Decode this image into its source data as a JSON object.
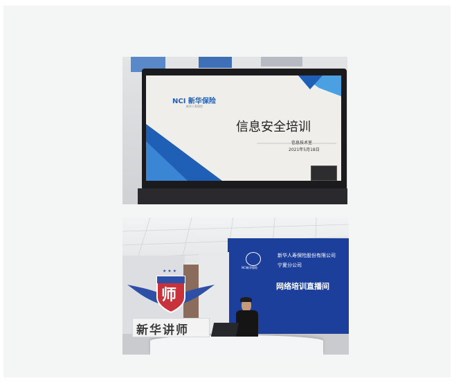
{
  "photo_laptop": {
    "slide": {
      "logo_text": "NCI 新华保险",
      "logo_tagline": "新华人寿保险",
      "title": "信息安全培训",
      "department": "信息技术室",
      "date": "2021年5月18日"
    }
  },
  "photo_studio": {
    "company_name": "新华人寿保险股份有限公司",
    "branch": "宁夏分公司",
    "room": "网络培训直播间",
    "lecturer_sign": "新华讲师",
    "emblem_char": "师",
    "logo_small": "NCI新华保险"
  },
  "colors": {
    "page_bg": "#f4f5f5",
    "brand_blue": "#1f5fb5",
    "wall_blue": "#1c3f9c",
    "laptop_black": "#1b1b1e"
  }
}
